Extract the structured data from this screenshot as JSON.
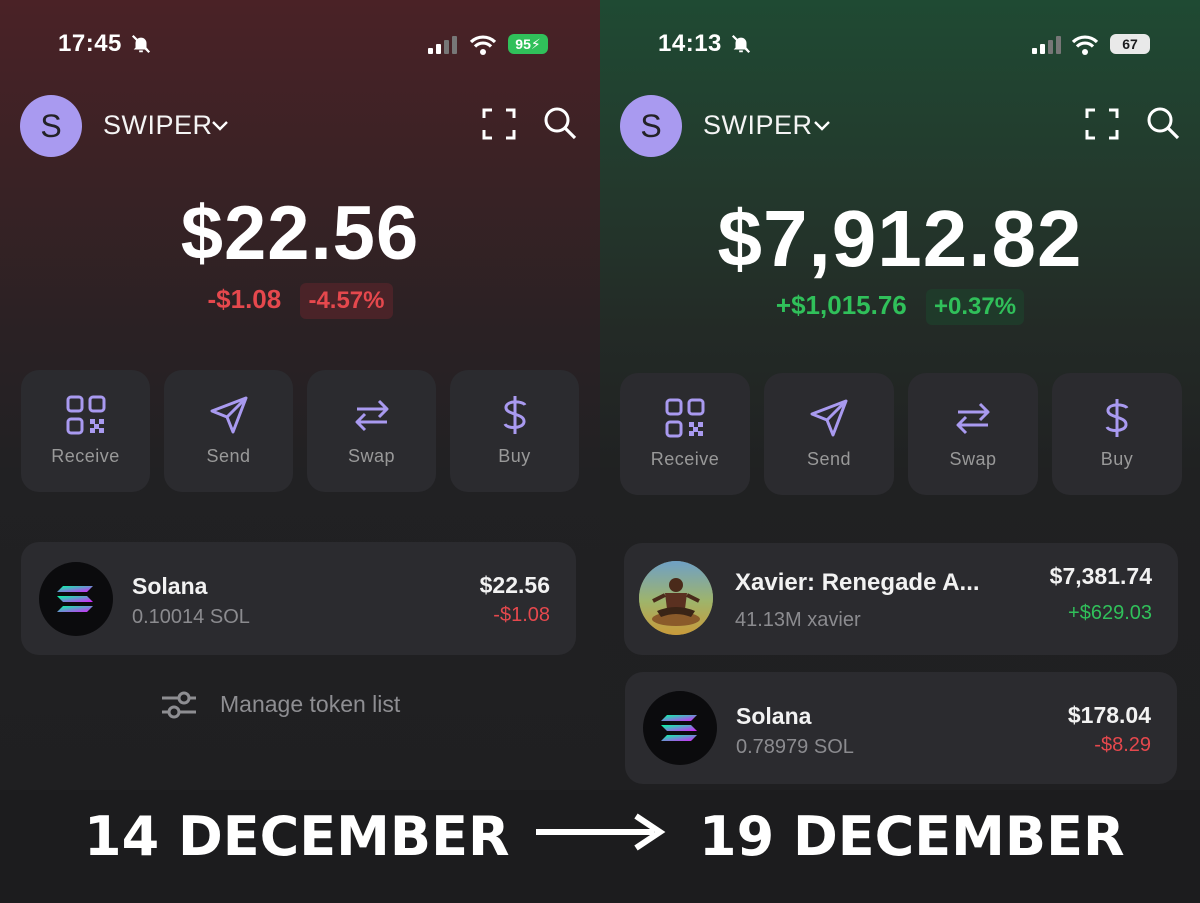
{
  "left": {
    "status": {
      "time": "17:45",
      "battery": "95"
    },
    "header": {
      "avatar_letter": "S",
      "wallet_name": "SWIPER"
    },
    "balance": "$22.56",
    "change": {
      "amount": "-$1.08",
      "percent": "-4.57%"
    },
    "actions": [
      {
        "label": "Receive",
        "icon": "qr-code-icon"
      },
      {
        "label": "Send",
        "icon": "paper-plane-icon"
      },
      {
        "label": "Swap",
        "icon": "swap-arrows-icon"
      },
      {
        "label": "Buy",
        "icon": "dollar-icon"
      }
    ],
    "tokens": [
      {
        "name": "Solana",
        "amount": "0.10014 SOL",
        "value": "$22.56",
        "delta": "-$1.08"
      }
    ],
    "manage_label": "Manage token list"
  },
  "right": {
    "status": {
      "time": "14:13",
      "battery": "67"
    },
    "header": {
      "avatar_letter": "S",
      "wallet_name": "SWIPER"
    },
    "balance": "$7,912.82",
    "change": {
      "amount": "+$1,015.76",
      "percent": "+0.37%"
    },
    "actions": [
      {
        "label": "Receive",
        "icon": "qr-code-icon"
      },
      {
        "label": "Send",
        "icon": "paper-plane-icon"
      },
      {
        "label": "Swap",
        "icon": "swap-arrows-icon"
      },
      {
        "label": "Buy",
        "icon": "dollar-icon"
      }
    ],
    "tokens": [
      {
        "name": "Xavier: Renegade A...",
        "amount": "41.13M xavier",
        "value": "$7,381.74",
        "delta": "+$629.03"
      },
      {
        "name": "Solana",
        "amount": "0.78979 SOL",
        "value": "$178.04",
        "delta": "-$8.29"
      }
    ]
  },
  "caption": {
    "from": "14 DECEMBER",
    "to": "19 DECEMBER"
  },
  "colors": {
    "negative": "#e5484d",
    "positive": "#30c05a",
    "accent": "#a99af0",
    "card": "#2b2b2f"
  }
}
